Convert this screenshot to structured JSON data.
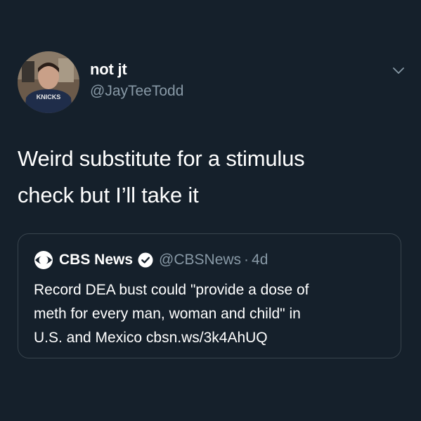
{
  "tweet": {
    "display_name": "not jt",
    "handle": "@JayTeeTodd",
    "text_line1": "Weird substitute for a stimulus",
    "text_line2": "check but I’ll take it",
    "avatar_icon": "profile-photo",
    "menu_icon": "chevron-down-icon"
  },
  "quoted": {
    "display_name": "CBS News",
    "handle": "@CBSNews",
    "separator": "·",
    "time": "4d",
    "text_line1": "Record DEA bust could \"provide a dose of",
    "text_line2": "meth for every man, woman and child\" in",
    "text_line3": "U.S. and Mexico cbsn.ws/3k4AhUQ",
    "logo_icon": "cbs-eye-icon",
    "verified_icon": "verified-badge-icon"
  },
  "colors": {
    "background": "#15202b",
    "text": "#ffffff",
    "secondary_text": "#8899a6",
    "border": "#38444d"
  }
}
